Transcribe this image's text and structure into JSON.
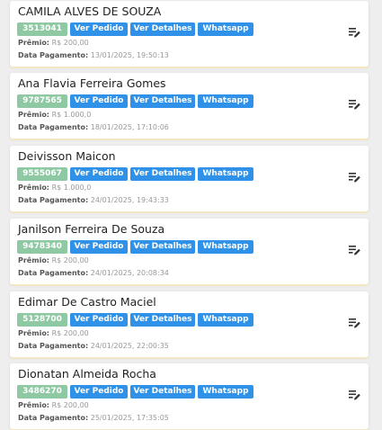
{
  "labels": {
    "premio": "Prêmio:",
    "data_pagamento": "Data Pagamento:",
    "ver_pedido": "Ver Pedido",
    "ver_detalhes": "Ver Detalhes",
    "whatsapp": "Whatsapp"
  },
  "colors": {
    "id_badge": "#8fc9a3",
    "button": "#2f91e8"
  },
  "icons": {
    "action": "edit-list-icon"
  },
  "entries": [
    {
      "name": "CAMILA ALVES DE SOUZA",
      "id": "3513041",
      "premio": "R$ 200,00",
      "data": "13/01/2025, 19:50:13"
    },
    {
      "name": "Ana Flavia Ferreira Gomes",
      "id": "9787565",
      "premio": "R$ 1.000,0",
      "data": "18/01/2025, 17:10:06"
    },
    {
      "name": "Deivisson Maicon",
      "id": "9555067",
      "premio": "R$ 1.000,0",
      "data": "24/01/2025, 19:43:33"
    },
    {
      "name": "Janilson Ferreira De Souza",
      "id": "9478340",
      "premio": "R$ 200,00",
      "data": "24/01/2025, 20:08:34"
    },
    {
      "name": "Edimar De Castro Maciel",
      "id": "5128700",
      "premio": "R$ 200,00",
      "data": "24/01/2025, 22:00:35"
    },
    {
      "name": "Dionatan Almeida Rocha",
      "id": "3486270",
      "premio": "R$ 200,00",
      "data": "25/01/2025, 17:35:05"
    }
  ]
}
